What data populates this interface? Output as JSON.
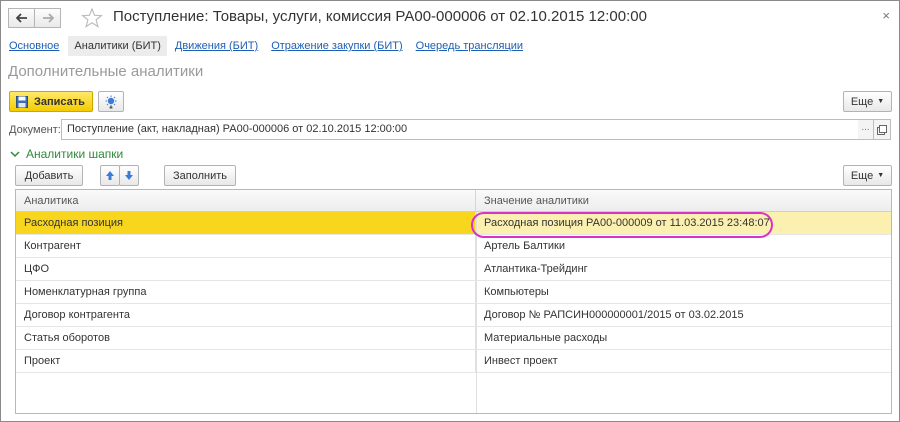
{
  "window": {
    "title": "Поступление: Товары, услуги, комиссия РА00-000006 от 02.10.2015 12:00:00",
    "close": "×"
  },
  "tabs": [
    {
      "label": "Основное",
      "active": false
    },
    {
      "label": "Аналитики (БИТ)",
      "active": true
    },
    {
      "label": "Движения (БИТ)",
      "active": false
    },
    {
      "label": "Отражение закупки (БИТ)",
      "active": false
    },
    {
      "label": "Очередь трансляции",
      "active": false
    }
  ],
  "section_title": "Дополнительные аналитики",
  "toolbar": {
    "save_label": "Записать",
    "more_label": "Еще"
  },
  "document": {
    "label": "Документ:",
    "value": "Поступление (акт, накладная) РА00-000006 от 02.10.2015 12:00:00",
    "dots": "..."
  },
  "group": {
    "title": "Аналитики шапки",
    "add_label": "Добавить",
    "fill_label": "Заполнить",
    "more_label": "Еще"
  },
  "table": {
    "columns": [
      "Аналитика",
      "Значение аналитики"
    ],
    "rows": [
      {
        "name": "Расходная позиция",
        "value": "Расходная позиция РА00-000009 от 11.03.2015 23:48:07"
      },
      {
        "name": "Контрагент",
        "value": "Артель Балтики"
      },
      {
        "name": "ЦФО",
        "value": "Атлантика-Трейдинг"
      },
      {
        "name": "Номенклатурная группа",
        "value": "Компьютеры"
      },
      {
        "name": "Договор контрагента",
        "value": "Договор № РАПСИН000000001/2015 от 03.02.2015"
      },
      {
        "name": "Статья оборотов",
        "value": "Материальные расходы"
      },
      {
        "name": "Проект",
        "value": "Инвест проект"
      }
    ],
    "selected_row": 0
  },
  "colors": {
    "accent_yellow": "#f9d61e",
    "link_blue": "#1d5fb5",
    "group_green": "#2e8b3b",
    "highlight_ring": "#d633c9"
  }
}
